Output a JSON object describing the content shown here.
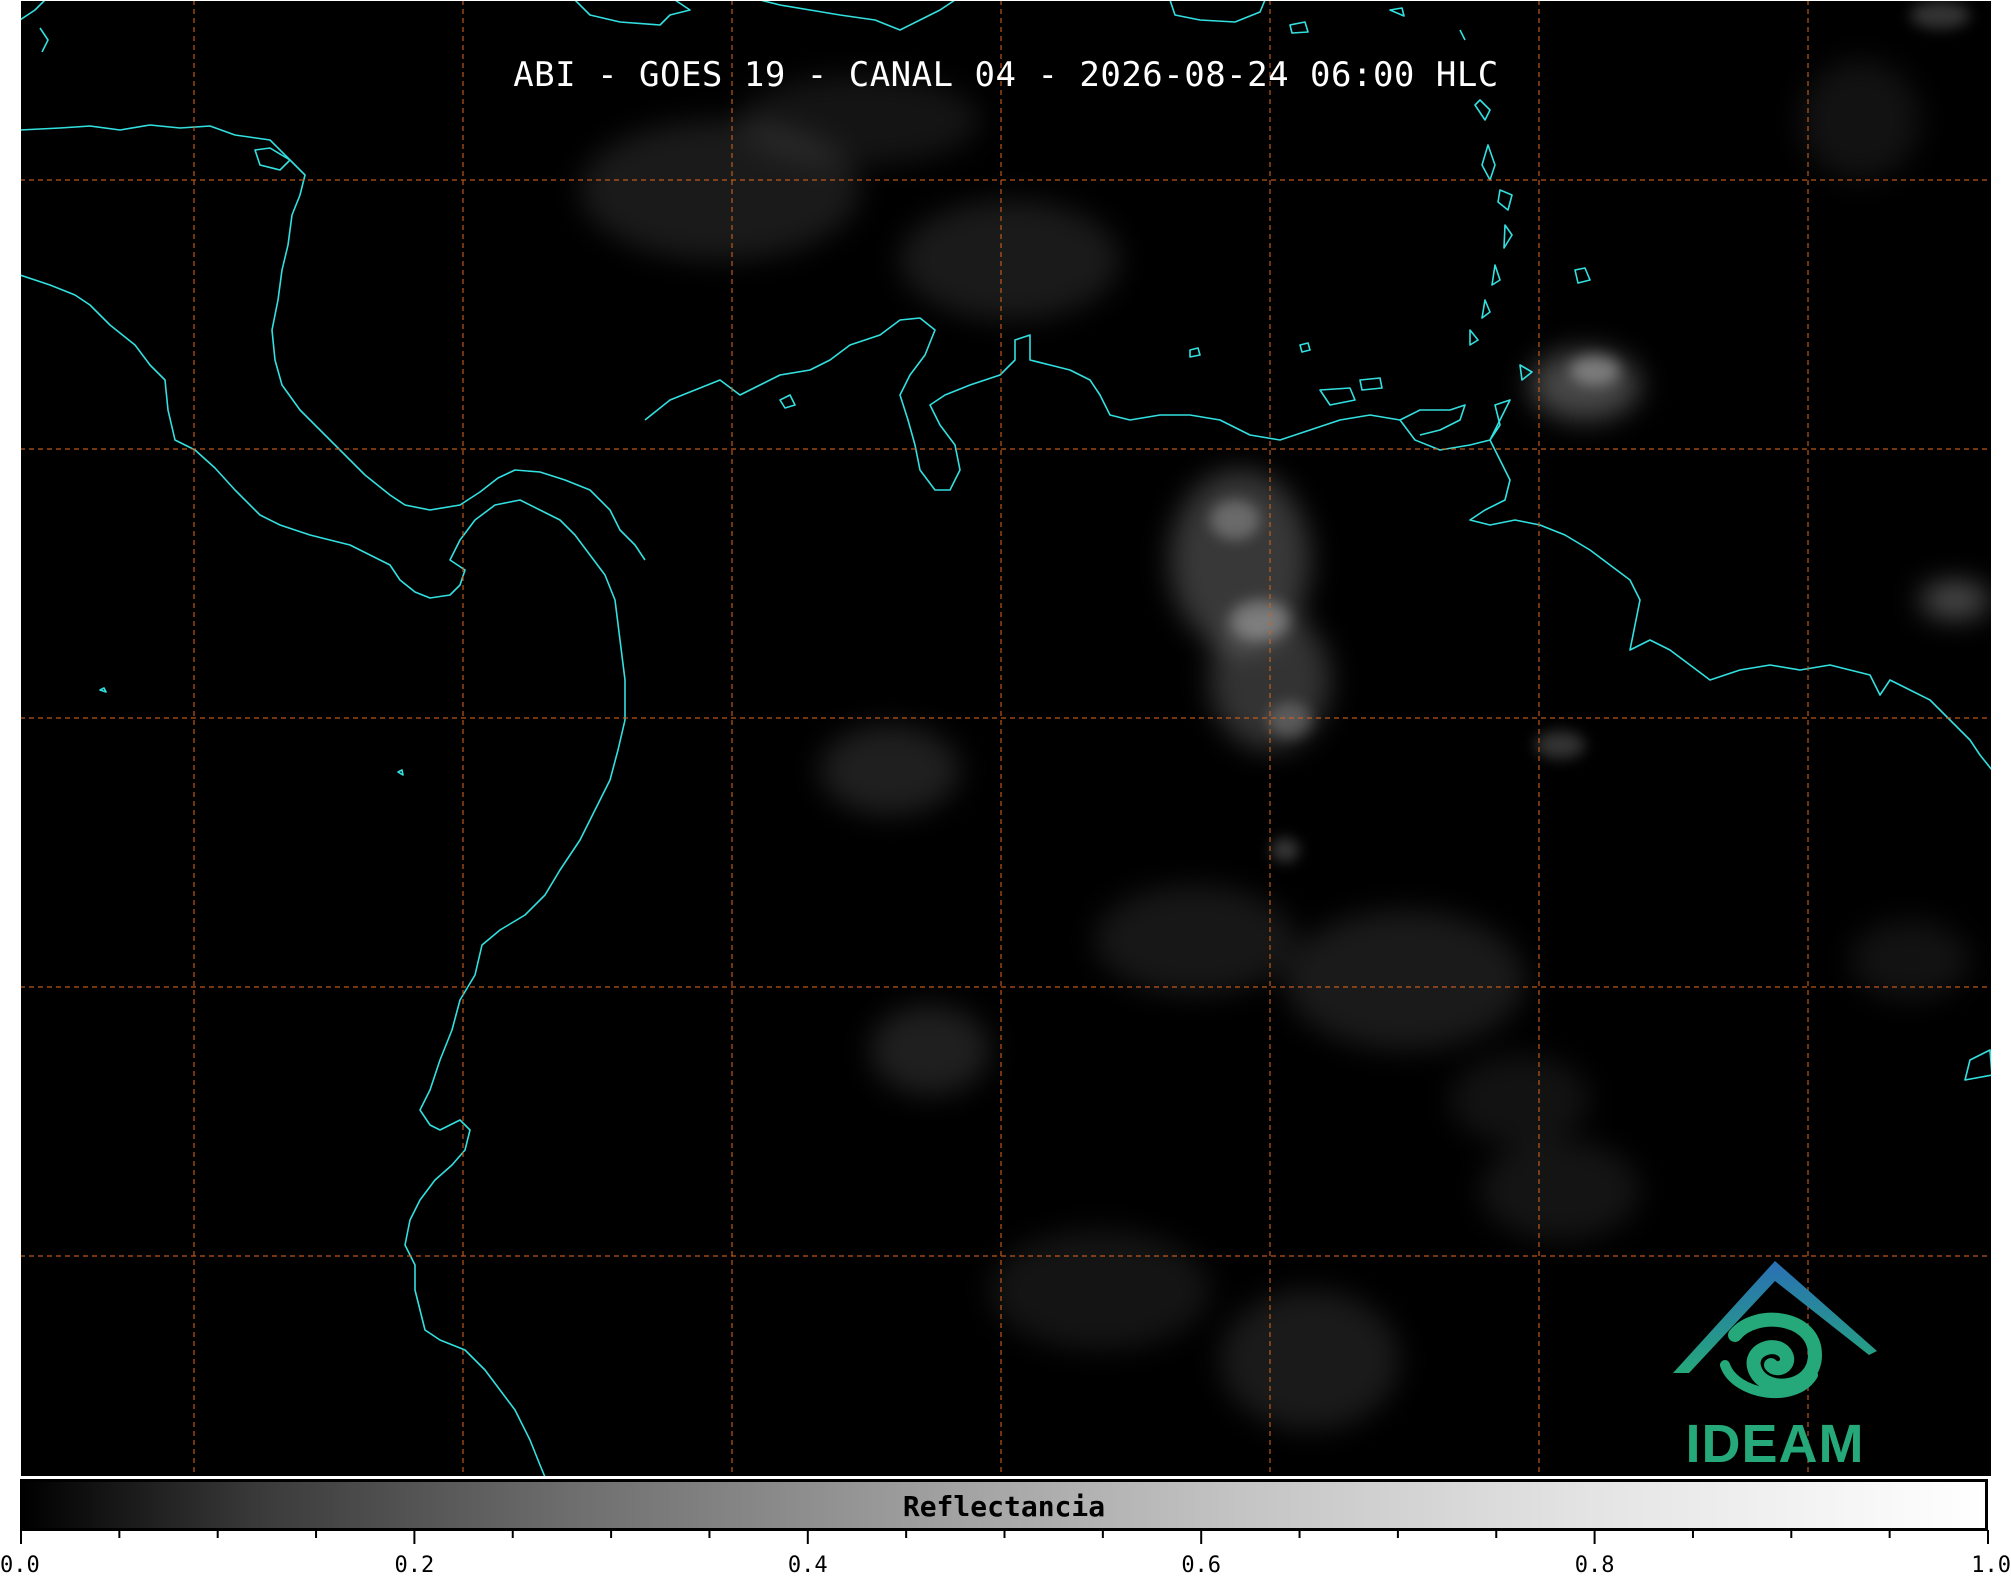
{
  "title": "ABI - GOES 19 - CANAL 04 - 2026-08-24 06:00 HLC",
  "colors": {
    "background": "#000000",
    "coastline": "#33e0e0",
    "gridline": "#d0621f",
    "logo_primary": "#25a87a",
    "logo_secondary": "#2a6fb5"
  },
  "colorbar": {
    "label": "Reflectancia",
    "range": [
      0.0,
      1.0
    ],
    "major_ticks": [
      "0.0",
      "0.2",
      "0.4",
      "0.6",
      "0.8",
      "1.0"
    ],
    "colormap": "grayscale"
  },
  "logo": {
    "text": "IDEAM",
    "icon": "ideam-mountain-swirl-icon"
  },
  "map": {
    "grid": "dashed",
    "coastlines": true
  }
}
